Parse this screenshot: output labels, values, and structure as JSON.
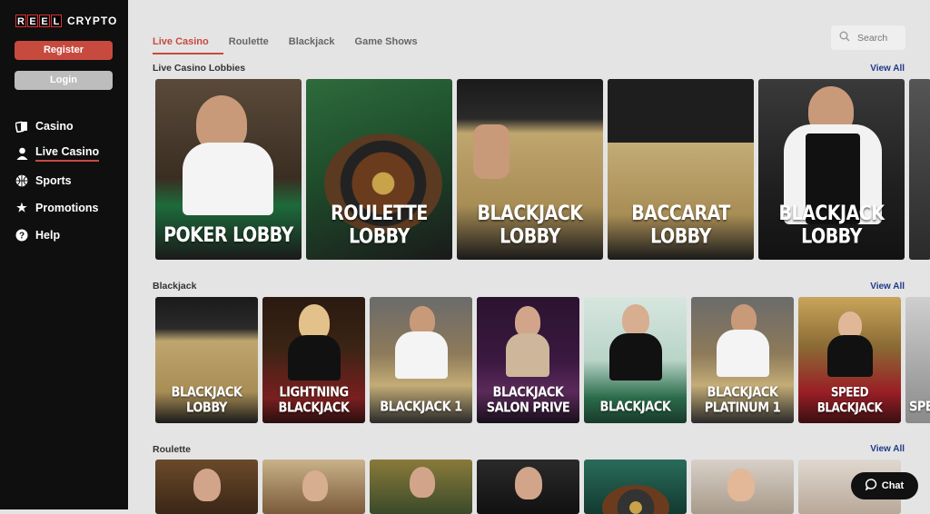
{
  "brand": {
    "reel_letters": [
      "R",
      "E",
      "E",
      "L"
    ],
    "crypto": "CRYPTO"
  },
  "auth": {
    "register": "Register",
    "login": "Login"
  },
  "nav": [
    {
      "label": "Casino",
      "icon": "cards-icon"
    },
    {
      "label": "Live Casino",
      "icon": "user-icon",
      "active": true
    },
    {
      "label": "Sports",
      "icon": "ball-icon"
    },
    {
      "label": "Promotions",
      "icon": "star-icon"
    },
    {
      "label": "Help",
      "icon": "question-icon"
    }
  ],
  "tabs": [
    {
      "label": "Live Casino",
      "active": true
    },
    {
      "label": "Roulette"
    },
    {
      "label": "Blackjack"
    },
    {
      "label": "Game Shows"
    }
  ],
  "search": {
    "placeholder": "Search"
  },
  "sections": {
    "lobbies": {
      "title": "Live Casino Lobbies",
      "view_all": "View All",
      "cards": [
        "POKER LOBBY",
        "ROULETTE LOBBY",
        "BLACKJACK LOBBY",
        "BACCARAT LOBBY",
        "BLACKJACK LOBBY"
      ]
    },
    "blackjack": {
      "title": "Blackjack",
      "view_all": "View All",
      "cards": [
        "BLACKJACK LOBBY",
        "LIGHTNING BLACKJACK",
        "BLACKJACK 1",
        "BLACKJACK SALON PRIVE",
        "BLACKJACK",
        "BLACKJACK PLATINUM 1",
        "SPEED BLACKJACK",
        "SPE"
      ]
    },
    "roulette": {
      "title": "Roulette",
      "view_all": "View All"
    }
  },
  "chat": {
    "label": "Chat"
  },
  "colors": {
    "accent": "#c74a3f",
    "sidebar": "#0f0f0f",
    "link": "#1f3a8a"
  }
}
